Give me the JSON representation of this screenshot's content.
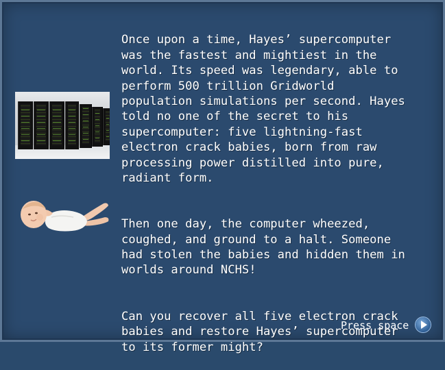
{
  "story": {
    "paragraphs": [
      "Once upon a time, Hayes’ supercomputer\nwas the fastest and mightiest in the\nworld. Its speed was legendary, able to\nperform 500 trillion Gridworld\npopulation simulations per second. Hayes\ntold no one of the secret to his\nsupercomputer: five lightning-fast\nelectron crack babies, born from raw\nprocessing power distilled into pure,\nradiant form.",
      "Then one day, the computer wheezed,\ncoughed, and ground to a halt. Someone\nhad stolen the babies and hidden them in\nworlds around NCHS!",
      "Can you recover all five electron crack\nbabies and restore Hayes’ supercomputer\nto its former might?"
    ]
  },
  "prompt": {
    "label": "Press space"
  },
  "icons": {
    "next": "play-arrow-icon"
  },
  "colors": {
    "background": "#2b4a6e",
    "border": "#5d7896",
    "text": "#ffffff"
  }
}
